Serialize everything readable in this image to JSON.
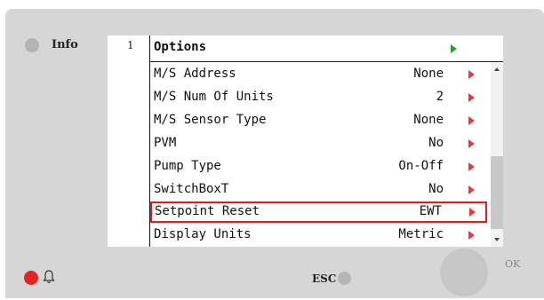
{
  "info_label": "Info",
  "esc_label": "ESC",
  "ok_label": "OK",
  "screen": {
    "line_number": "1",
    "title": "Options",
    "rows": [
      {
        "label": "M/S Address",
        "value": "None"
      },
      {
        "label": "M/S Num Of Units",
        "value": "2"
      },
      {
        "label": "M/S Sensor Type",
        "value": "None"
      },
      {
        "label": "PVM",
        "value": "No"
      },
      {
        "label": "Pump Type",
        "value": "On-Off"
      },
      {
        "label": "SwitchBoxT",
        "value": "No"
      },
      {
        "label": "Setpoint Reset",
        "value": "EWT",
        "selected": true
      },
      {
        "label": "Display Units",
        "value": "Metric"
      }
    ]
  },
  "colors": {
    "panel": "#d6d6d6",
    "selection": "#e31b1b",
    "submenu_arrow": "#e63a3a",
    "header_arrow": "#1fa61f",
    "alarm_led": "#e82222",
    "idle_led": "#b3b3b3"
  },
  "icons": [
    "info-led-icon",
    "bell-icon",
    "esc-led-icon",
    "ok-knob-icon",
    "scroll-up-icon",
    "scroll-down-icon"
  ]
}
